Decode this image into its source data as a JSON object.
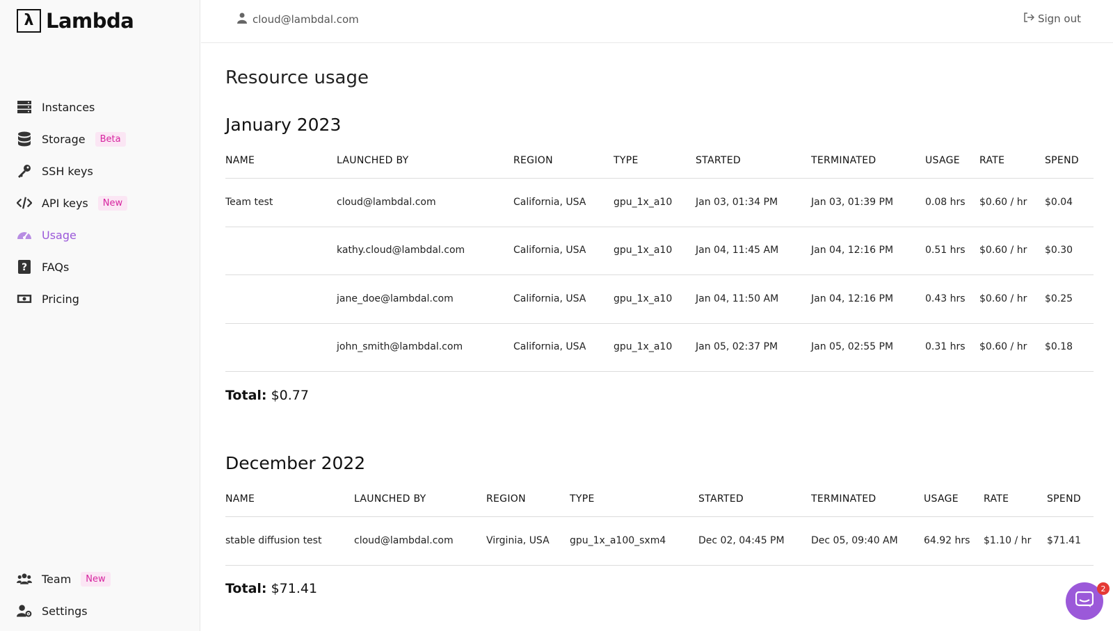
{
  "brand": {
    "name": "Lambda",
    "logo_glyph": "λ"
  },
  "sidebar": {
    "items": [
      {
        "label": "Instances",
        "icon": "server-icon"
      },
      {
        "label": "Storage",
        "icon": "database-icon",
        "badge": "Beta"
      },
      {
        "label": "SSH keys",
        "icon": "key-icon"
      },
      {
        "label": "API keys",
        "icon": "code-icon",
        "badge": "New"
      },
      {
        "label": "Usage",
        "icon": "gauge-icon",
        "active": true
      },
      {
        "label": "FAQs",
        "icon": "question-icon"
      },
      {
        "label": "Pricing",
        "icon": "money-icon"
      }
    ],
    "bottom_items": [
      {
        "label": "Team",
        "icon": "users-icon",
        "badge": "New"
      },
      {
        "label": "Settings",
        "icon": "user-settings-icon"
      }
    ]
  },
  "header": {
    "user_email": "cloud@lambdal.com",
    "sign_out_label": "Sign out"
  },
  "page": {
    "title": "Resource usage"
  },
  "months": [
    {
      "title": "January 2023",
      "columns": [
        "NAME",
        "LAUNCHED BY",
        "REGION",
        "TYPE",
        "STARTED",
        "TERMINATED",
        "USAGE",
        "RATE",
        "SPEND"
      ],
      "rows": [
        [
          "Team test",
          "cloud@lambdal.com",
          "California, USA",
          "gpu_1x_a10",
          "Jan 03, 01:34 PM",
          "Jan 03, 01:39 PM",
          "0.08 hrs",
          "$0.60 / hr",
          "$0.04"
        ],
        [
          "",
          "kathy.cloud@lambdal.com",
          "California, USA",
          "gpu_1x_a10",
          "Jan 04, 11:45 AM",
          "Jan 04, 12:16 PM",
          "0.51 hrs",
          "$0.60 / hr",
          "$0.30"
        ],
        [
          "",
          "jane_doe@lambdal.com",
          "California, USA",
          "gpu_1x_a10",
          "Jan 04, 11:50 AM",
          "Jan 04, 12:16 PM",
          "0.43 hrs",
          "$0.60 / hr",
          "$0.25"
        ],
        [
          "",
          "john_smith@lambdal.com",
          "California, USA",
          "gpu_1x_a10",
          "Jan 05, 02:37 PM",
          "Jan 05, 02:55 PM",
          "0.31 hrs",
          "$0.60 / hr",
          "$0.18"
        ]
      ],
      "total_label": "Total:",
      "total_value": "$0.77"
    },
    {
      "title": "December 2022",
      "columns": [
        "NAME",
        "LAUNCHED BY",
        "REGION",
        "TYPE",
        "STARTED",
        "TERMINATED",
        "USAGE",
        "RATE",
        "SPEND"
      ],
      "rows": [
        [
          "stable diffusion test",
          "cloud@lambdal.com",
          "Virginia, USA",
          "gpu_1x_a100_sxm4",
          "Dec 02, 04:45 PM",
          "Dec 05, 09:40 AM",
          "64.92 hrs",
          "$1.10 / hr",
          "$71.41"
        ]
      ],
      "total_label": "Total:",
      "total_value": "$71.41"
    }
  ],
  "chat": {
    "unread_count": "2",
    "icon": "chat-icon"
  },
  "colors": {
    "accent": "#9b59d9",
    "badge_text": "#d6249f",
    "badge_bg": "#fbe6f4"
  }
}
